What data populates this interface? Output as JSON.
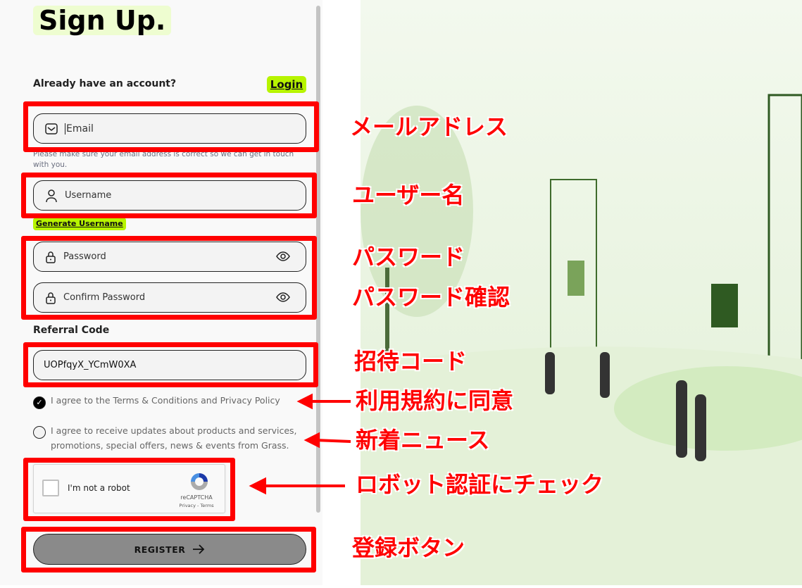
{
  "form": {
    "title": "Sign Up.",
    "already_text": "Already have an account?",
    "login_label": "Login",
    "email_placeholder": "Email",
    "email_hint": "Please make sure your email address is correct so we can get in touch with you.",
    "username_placeholder": "Username",
    "generate_username_label": "Generate Username",
    "password_placeholder": "Password",
    "confirm_password_placeholder": "Confirm Password",
    "referral_label": "Referral Code",
    "referral_value": "UOPfqyX_YCmW0XA",
    "terms_text": "I agree to the Terms & Conditions and Privacy Policy",
    "terms_checked": true,
    "updates_text": "I agree to receive updates about products and services, promotions, special offers, news & events from Grass.",
    "updates_checked": false,
    "captcha": {
      "label": "I'm not a robot",
      "brand": "reCAPTCHA",
      "links": "Privacy - Terms"
    },
    "register_label": "REGISTER"
  },
  "annotations": {
    "email": "メールアドレス",
    "username": "ユーザー名",
    "password": "パスワード",
    "confirm_password": "パスワード確認",
    "referral": "招待コード",
    "terms": "利用規約に同意",
    "updates": "新着ニュース",
    "captcha": "ロボット認証にチェック",
    "register": "登録ボタン",
    "color": "#ff0000"
  },
  "colors": {
    "accent": "#b7f400",
    "title_bg": "#eefdd0",
    "button": "#8a8a8a"
  }
}
